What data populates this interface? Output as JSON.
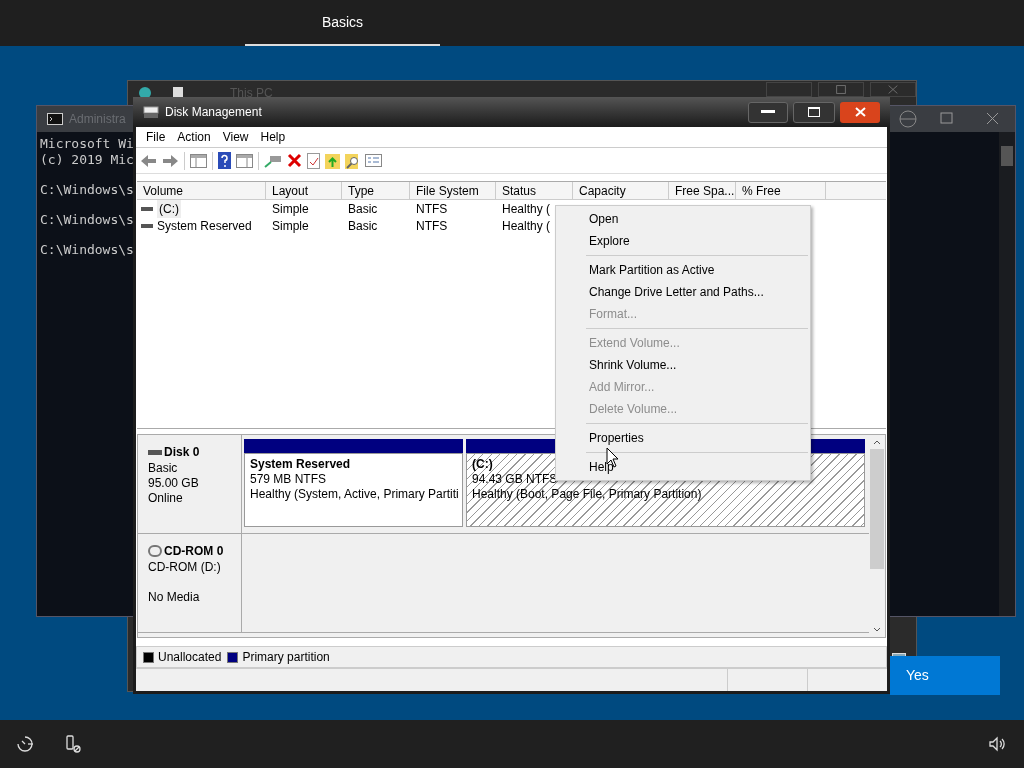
{
  "top_bar": {
    "tabs": [
      {
        "label": "Basics",
        "selected": true
      }
    ]
  },
  "explorer_window": {
    "title": "This PC"
  },
  "console_window": {
    "title": "Administra",
    "lines": [
      "Microsoft Wi",
      "(c) 2019 Mic",
      "C:\\Windows\\s",
      "C:\\Windows\\s",
      "C:\\Windows\\s"
    ]
  },
  "yes_button": {
    "label": "Yes"
  },
  "window": {
    "title": "Disk Management",
    "menu": [
      "File",
      "Action",
      "View",
      "Help"
    ],
    "table": {
      "columns": [
        "Volume",
        "Layout",
        "Type",
        "File System",
        "Status",
        "Capacity",
        "Free Spa...",
        "% Free"
      ],
      "rows": [
        {
          "cells": [
            "(C:)",
            "Simple",
            "Basic",
            "NTFS",
            "Healthy ("
          ],
          "focused": true
        },
        {
          "cells": [
            "System Reserved",
            "Simple",
            "Basic",
            "NTFS",
            "Healthy ("
          ],
          "focused": false
        }
      ]
    },
    "disks": [
      {
        "kind": "disk",
        "name": "Disk 0",
        "lines": [
          "Basic",
          "95.00 GB",
          "Online"
        ],
        "partitions": [
          {
            "name": "System Reserved",
            "size": "579 MB NTFS",
            "status": "Healthy (System, Active, Primary Partiti",
            "selected": false
          },
          {
            "name": "(C:)",
            "size": "94.43 GB NTFS",
            "status": "Healthy (Boot, Page File, Primary Partition)",
            "selected": true
          }
        ]
      },
      {
        "kind": "cdrom",
        "name": "CD-ROM 0",
        "lines": [
          "CD-ROM (D:)",
          "No Media"
        ]
      }
    ],
    "legend": [
      {
        "label": "Unallocated",
        "color": "#000000"
      },
      {
        "label": "Primary partition",
        "color": "#000080"
      }
    ]
  },
  "context_menu": {
    "items": [
      {
        "kind": "item",
        "label": "Open",
        "disabled": false
      },
      {
        "kind": "item",
        "label": "Explore",
        "disabled": false
      },
      {
        "kind": "separator"
      },
      {
        "kind": "item",
        "label": "Mark Partition as Active",
        "disabled": false
      },
      {
        "kind": "item",
        "label": "Change Drive Letter and Paths...",
        "disabled": false
      },
      {
        "kind": "item",
        "label": "Format...",
        "disabled": true
      },
      {
        "kind": "separator"
      },
      {
        "kind": "item",
        "label": "Extend Volume...",
        "disabled": true
      },
      {
        "kind": "item",
        "label": "Shrink Volume...",
        "disabled": false
      },
      {
        "kind": "item",
        "label": "Add Mirror...",
        "disabled": true
      },
      {
        "kind": "item",
        "label": "Delete Volume...",
        "disabled": true
      },
      {
        "kind": "separator"
      },
      {
        "kind": "item",
        "label": "Properties",
        "disabled": false
      },
      {
        "kind": "separator"
      },
      {
        "kind": "item",
        "label": "Help",
        "disabled": false
      }
    ]
  }
}
